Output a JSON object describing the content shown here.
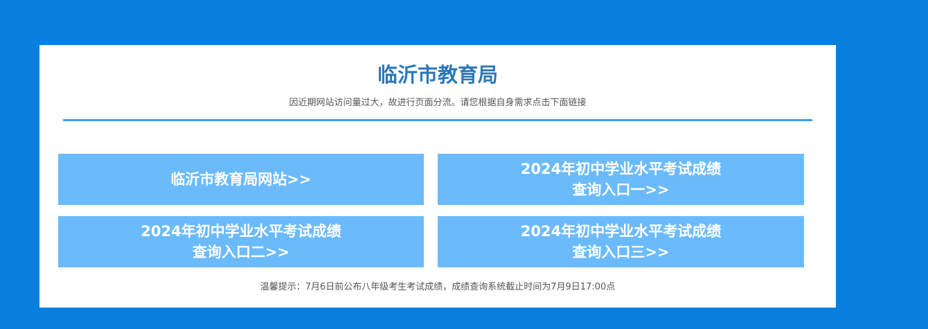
{
  "header": {
    "title": "临沂市教育局",
    "subtitle": "因近期网站访问量过大，故进行页面分流。请您根据自身需求点击下面链接"
  },
  "links": [
    {
      "line1": "临沂市教育局网站>>",
      "line2": ""
    },
    {
      "line1": "2024年初中学业水平考试成绩",
      "line2": "查询入口一>>"
    },
    {
      "line1": "2024年初中学业水平考试成绩",
      "line2": "查询入口二>>"
    },
    {
      "line1": "2024年初中学业水平考试成绩",
      "line2": "查询入口三>>"
    }
  ],
  "footer": {
    "notice": "温馨提示：7月6日前公布八年级考生考试成绩，成绩查询系统截止时间为7月9日17:00点"
  },
  "colors": {
    "background": "#0780dd",
    "panel": "#ffffff",
    "title": "#2b78b8",
    "divider": "#3aa0ec",
    "button": "#6bbbfc",
    "button_text": "#ffffff",
    "body_text": "#555555"
  }
}
